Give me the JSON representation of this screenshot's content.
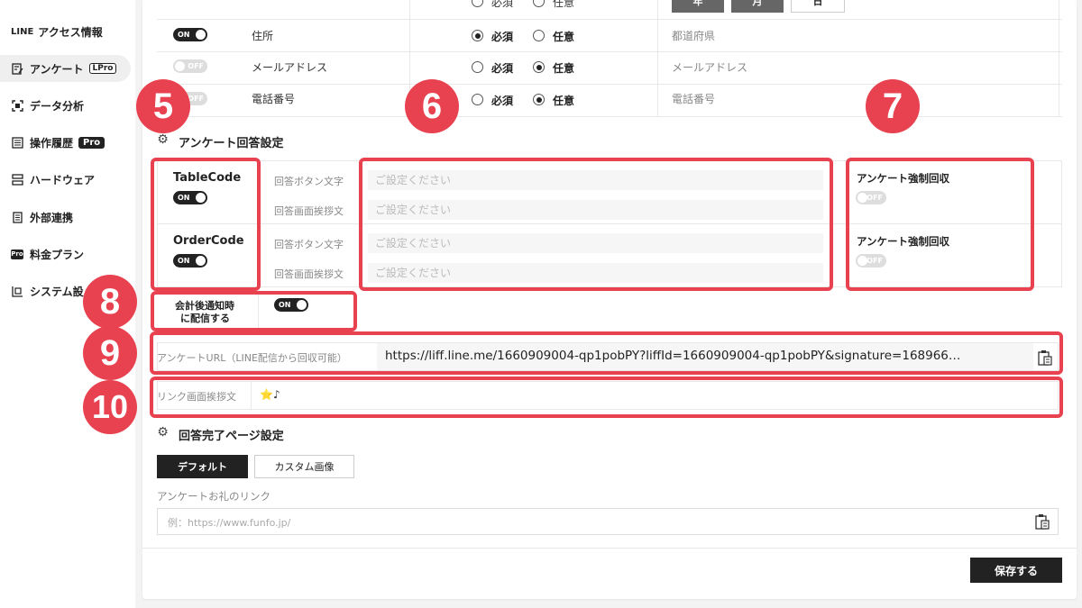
{
  "sidebar": {
    "items": [
      {
        "label": "アクセス情報",
        "icon": "line-logo-icon",
        "iconText": "LINE"
      },
      {
        "label": "アンケート",
        "icon": "form-edit-icon",
        "badge": "LPro"
      },
      {
        "label": "データ分析",
        "icon": "scan-icon"
      },
      {
        "label": "操作履歴",
        "icon": "list-icon",
        "badge": "Pro"
      },
      {
        "label": "ハードウェア",
        "icon": "hardware-icon"
      },
      {
        "label": "外部連携",
        "icon": "document-icon"
      },
      {
        "label": "料金プラン",
        "icon": "pro-icon",
        "iconText": "Pro"
      },
      {
        "label": "システム設",
        "icon": "system-icon"
      }
    ]
  },
  "fields_table": {
    "rows": [
      {
        "label": "住所",
        "toggle": "ON",
        "required_label": "必須",
        "optional_label": "任意",
        "required": true,
        "placeholder": "都道府県"
      },
      {
        "label": "メールアドレス",
        "toggle": "OFF",
        "required_label": "必須",
        "optional_label": "任意",
        "required": false,
        "placeholder": "メールアドレス"
      },
      {
        "label": "電話番号",
        "toggle": "OFF",
        "required_label": "必須",
        "optional_label": "任意",
        "required": false,
        "placeholder": "電話番号"
      }
    ],
    "top_row": {
      "required_label": "必須",
      "optional_label": "任意",
      "buttons": [
        "年",
        "月",
        "日"
      ]
    }
  },
  "answer_settings": {
    "title": "アンケート回答設定",
    "blocks": [
      {
        "name": "TableCode",
        "toggle": "ON",
        "button_text_label": "回答ボタン文字",
        "greeting_label": "回答画面挨拶文",
        "placeholder": "ご設定ください",
        "force_label": "アンケート強制回収",
        "force_toggle": "OFF"
      },
      {
        "name": "OrderCode",
        "toggle": "ON",
        "button_text_label": "回答ボタン文字",
        "greeting_label": "回答画面挨拶文",
        "placeholder": "ご設定ください",
        "force_label": "アンケート強制回収",
        "force_toggle": "OFF"
      }
    ],
    "post_pay_label_1": "会計後通知時",
    "post_pay_label_2": "に配信する",
    "post_pay_toggle": "ON",
    "url_label": "アンケートURL（LINE配信から回収可能）",
    "url_value": "https://liff.line.me/1660909004-qp1pobPY?liffId=1660909004-qp1pobPY&signature=168966…",
    "link_greeting_label": "リンク画面挨拶文",
    "link_greeting_value": "⭐♪"
  },
  "complete_page": {
    "title": "回答完了ページ設定",
    "tab_default": "デフォルト",
    "tab_custom": "カスタム画像",
    "thanks_link_label": "アンケートお礼のリンク",
    "thanks_link_placeholder": "例：https://www.funfo.jp/"
  },
  "save_label": "保存する",
  "annotations": [
    "5",
    "6",
    "7",
    "8",
    "9",
    "10"
  ],
  "colors": {
    "accent_red": "#e8414f",
    "dark": "#222222"
  }
}
